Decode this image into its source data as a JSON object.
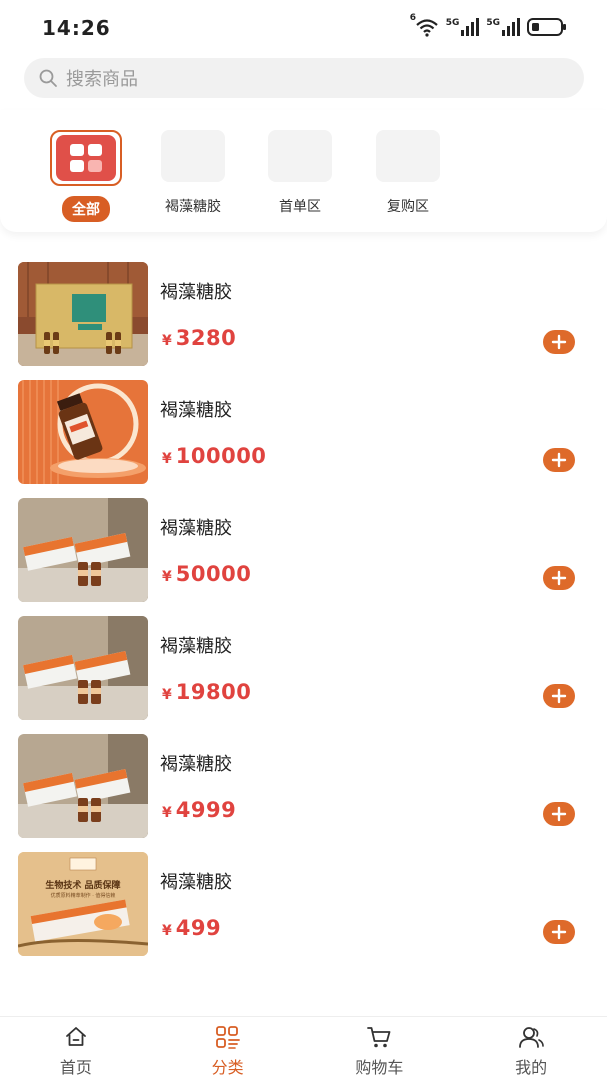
{
  "status_bar": {
    "time": "14:26",
    "signal1": "5G",
    "signal2": "5G",
    "wifi_badge": "6"
  },
  "search": {
    "placeholder": "搜索商品"
  },
  "categories": [
    {
      "label": "全部",
      "active": true
    },
    {
      "label": "褐藻糖胶",
      "active": false
    },
    {
      "label": "首单区",
      "active": false
    },
    {
      "label": "复购区",
      "active": false
    }
  ],
  "currency_symbol": "¥",
  "products": [
    {
      "name": "褐藻糖胶",
      "price": "3280",
      "image": "gift-box-with-bottles"
    },
    {
      "name": "褐藻糖胶",
      "price": "100000",
      "image": "single-bottle-orange"
    },
    {
      "name": "褐藻糖胶",
      "price": "50000",
      "image": "boxes-and-bottles"
    },
    {
      "name": "褐藻糖胶",
      "price": "19800",
      "image": "boxes-and-bottles"
    },
    {
      "name": "褐藻糖胶",
      "price": "4999",
      "image": "boxes-and-bottles"
    },
    {
      "name": "褐藻糖胶",
      "price": "499",
      "image": "bio-tech-poster"
    }
  ],
  "poster_text": {
    "line1": "生物技术 品质保障",
    "line2": "优质原料精萃制作 · 值得信赖"
  },
  "bottom_nav": [
    {
      "label": "首页",
      "icon": "home-icon",
      "active": false
    },
    {
      "label": "分类",
      "icon": "category-icon",
      "active": true
    },
    {
      "label": "购物车",
      "icon": "cart-icon",
      "active": false
    },
    {
      "label": "我的",
      "icon": "user-icon",
      "active": false
    }
  ],
  "colors": {
    "accent": "#d85e24",
    "price": "#e0433f",
    "add_button": "#de6a2a",
    "category_active_tile": "#e05049"
  }
}
